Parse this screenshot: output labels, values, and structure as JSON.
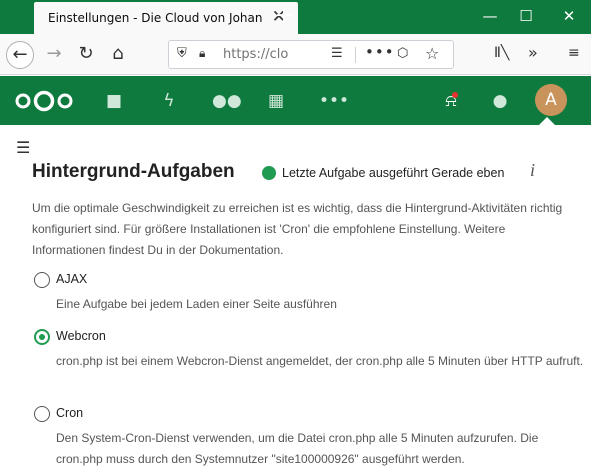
{
  "browser": {
    "tab_title": "Einstellungen - Die Cloud von Johan",
    "tab_close": "✕",
    "new_tab": "+",
    "url": "https://clo",
    "window_controls": {
      "minimize": "—",
      "maximize": "☐",
      "close": "✕"
    }
  },
  "nc": {
    "avatar_letter": "A",
    "accent": "#0f7a3e"
  },
  "section": {
    "title": "Hintergrund-Aufgaben",
    "status": "Letzte Aufgabe ausgeführt Gerade eben",
    "info": "i",
    "intro": "Um die optimale Geschwindigkeit zu erreichen ist es wichtig, dass die Hintergrund-Aktivitäten richtig konfiguriert sind. Für größere Installationen ist 'Cron' die empfohlene Einstellung. Weitere Informationen findest Du in der Dokumentation."
  },
  "options": [
    {
      "label": "AJAX",
      "desc": "Eine Aufgabe bei jedem Laden einer Seite ausführen",
      "checked": false
    },
    {
      "label": "Webcron",
      "desc": "cron.php ist bei einem Webcron-Dienst angemeldet, der cron.php alle 5 Minuten über HTTP aufruft.",
      "checked": true
    },
    {
      "label": "Cron",
      "desc": "Den System-Cron-Dienst verwenden, um die Datei cron.php alle 5 Minuten aufzurufen. Die cron.php muss durch den Systemnutzer \"site100000926\" ausgeführt werden.",
      "checked": false
    }
  ]
}
